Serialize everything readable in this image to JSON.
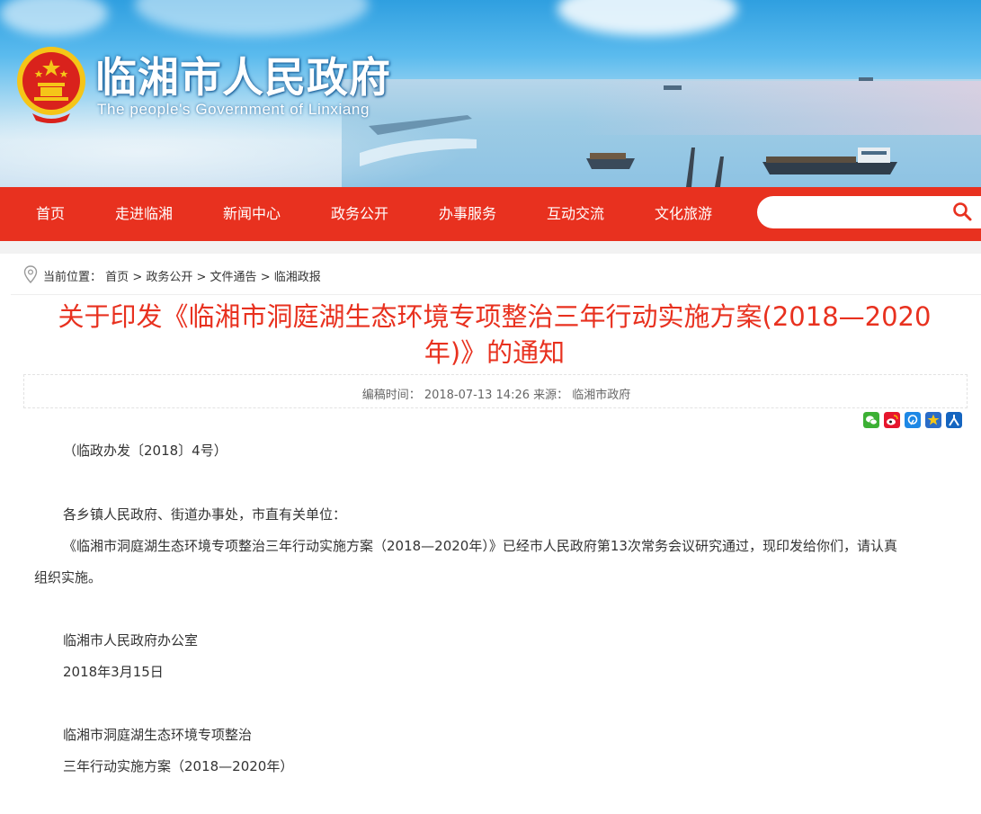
{
  "header": {
    "site_title": "临湘市人民政府",
    "site_subtitle": "The people's Government of Linxiang",
    "emblem_icon": "national-emblem-icon"
  },
  "nav": {
    "items": [
      {
        "label": "首页"
      },
      {
        "label": "走进临湘"
      },
      {
        "label": "新闻中心"
      },
      {
        "label": "政务公开"
      },
      {
        "label": "办事服务"
      },
      {
        "label": "互动交流"
      },
      {
        "label": "文化旅游"
      }
    ],
    "search": {
      "value": "",
      "placeholder": "",
      "icon": "search-icon"
    }
  },
  "breadcrumb": {
    "prefix": "当前位置：",
    "items": [
      "首页",
      "政务公开",
      "文件通告",
      "临湘政报"
    ],
    "separator": ">"
  },
  "article": {
    "title_line1": "关于印发《临湘市洞庭湖生态环境专项整治三年行动实施方案(2018—2020",
    "title_line2": "年)》的通知",
    "meta_label_time": "编稿时间：",
    "meta_time": "2018-07-13 14:26",
    "meta_label_source": "来源：",
    "meta_source": "临湘市政府",
    "share_icons": [
      "wechat-icon",
      "weibo-icon",
      "qzone-icon",
      "star-icon",
      "renren-icon"
    ],
    "paragraphs": {
      "doc_number": "（临政办发〔2018〕4号）",
      "salutation": "各乡镇人民政府、街道办事处，市直有关单位：",
      "body_line1": "《临湘市洞庭湖生态环境专项整治三年行动实施方案（2018—2020年）》已经市人民政府第13次常务会议研究通过，现印发给你们，请认真",
      "body_line2": "组织实施。",
      "signature": "临湘市人民政府办公室",
      "date": "2018年3月15日",
      "plan_title_line1": "临湘市洞庭湖生态环境专项整治",
      "plan_title_line2": "三年行动实施方案（2018—2020年）"
    }
  },
  "colors": {
    "nav_red": "#e8311f",
    "title_red": "#e8311f"
  }
}
